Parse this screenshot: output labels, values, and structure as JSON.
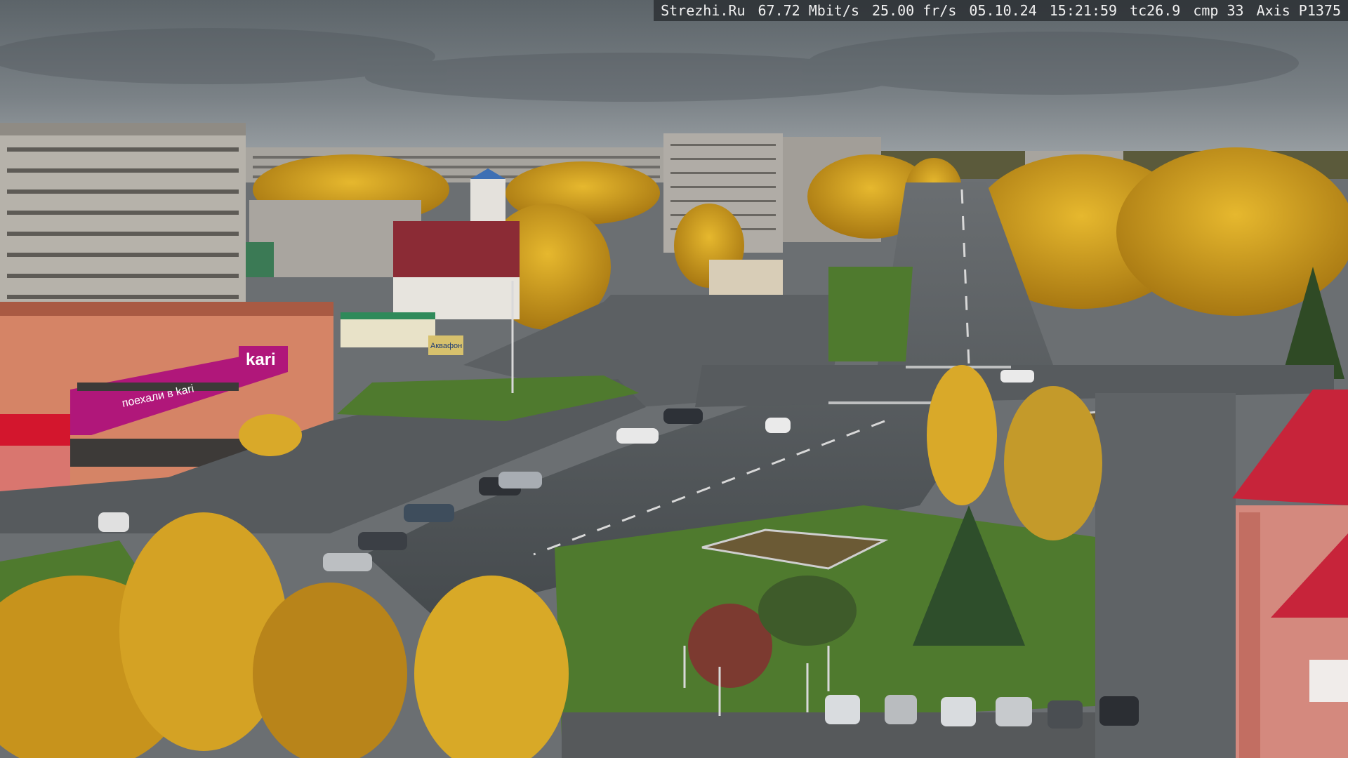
{
  "overlay": {
    "site": "Strezhi.Ru",
    "bitrate": "67.72 Mbit/s",
    "framerate": "25.00 fr/s",
    "date": "05.10.24",
    "time": "15:21:59",
    "tc": "tc26.9",
    "cmp": "cmp 33",
    "camera": "Axis P1375"
  },
  "signs": {
    "store_kari": "kari",
    "store_banner": "поехали в kari",
    "akvafon": "Аквафон"
  },
  "colors": {
    "sky": "#6f777d",
    "autumn_gold": "#d1a021",
    "road": "#4f5356",
    "grass": "#4f7a2e",
    "kari_magenta": "#b0177a",
    "roof_red": "#c7243a"
  }
}
